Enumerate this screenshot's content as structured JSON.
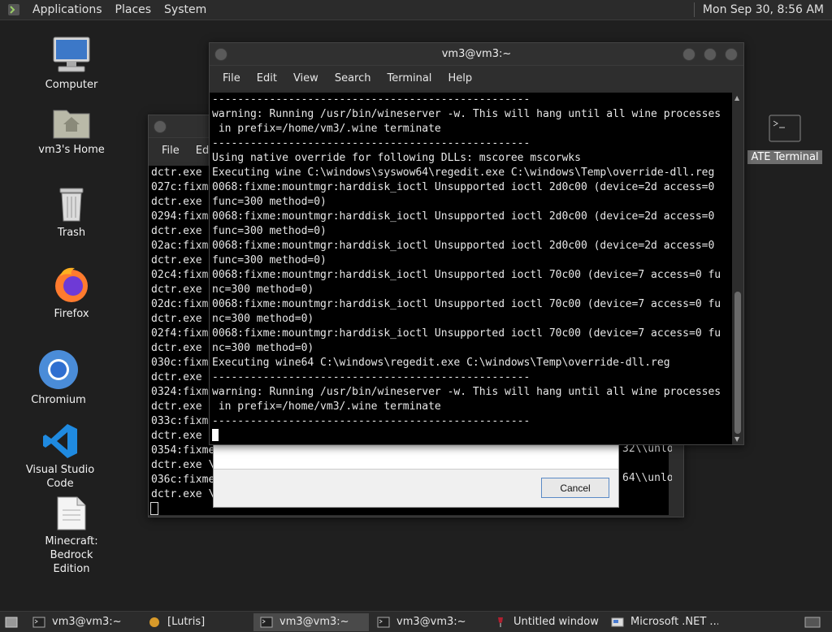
{
  "top_panel": {
    "menus": [
      "Applications",
      "Places",
      "System"
    ],
    "clock": "Mon Sep 30,  8:56 AM"
  },
  "desktop_icons": [
    {
      "label": "Computer",
      "icon": "computer-icon"
    },
    {
      "label": "vm3's Home",
      "icon": "home-folder-icon"
    },
    {
      "label": "Trash",
      "icon": "trash-icon"
    },
    {
      "label": "Firefox",
      "icon": "firefox-icon"
    },
    {
      "label": "Chromium",
      "icon": "chromium-icon"
    },
    {
      "label": "Visual Studio Code",
      "icon": "vscode-icon"
    },
    {
      "label": "Minecraft: Bedrock\nEdition",
      "icon": "document-icon"
    }
  ],
  "main_terminal": {
    "title": "vm3@vm3:~",
    "menu": [
      "File",
      "Edit",
      "View",
      "Search",
      "Terminal",
      "Help"
    ],
    "lines": [
      "--------------------------------------------------",
      "warning: Running /usr/bin/wineserver -w. This will hang until all wine processes",
      " in prefix=/home/vm3/.wine terminate",
      "--------------------------------------------------",
      "Using native override for following DLLs: mscoree mscorwks",
      "Executing wine C:\\windows\\syswow64\\regedit.exe C:\\windows\\Temp\\override-dll.reg",
      "0068:fixme:mountmgr:harddisk_ioctl Unsupported ioctl 2d0c00 (device=2d access=0",
      "func=300 method=0)",
      "0068:fixme:mountmgr:harddisk_ioctl Unsupported ioctl 2d0c00 (device=2d access=0",
      "func=300 method=0)",
      "0068:fixme:mountmgr:harddisk_ioctl Unsupported ioctl 2d0c00 (device=2d access=0",
      "func=300 method=0)",
      "0068:fixme:mountmgr:harddisk_ioctl Unsupported ioctl 70c00 (device=7 access=0 fu",
      "nc=300 method=0)",
      "0068:fixme:mountmgr:harddisk_ioctl Unsupported ioctl 70c00 (device=7 access=0 fu",
      "nc=300 method=0)",
      "0068:fixme:mountmgr:harddisk_ioctl Unsupported ioctl 70c00 (device=7 access=0 fu",
      "nc=300 method=0)",
      "Executing wine64 C:\\windows\\regedit.exe C:\\windows\\Temp\\override-dll.reg",
      "--------------------------------------------------",
      "warning: Running /usr/bin/wineserver -w. This will hang until all wine processes",
      " in prefix=/home/vm3/.wine terminate",
      "--------------------------------------------------"
    ]
  },
  "back_terminal": {
    "menu": [
      "File",
      "Edit"
    ],
    "lines": [
      "dctr.exe",
      "027c:fixme",
      "dctr.exe",
      "0294:fixme",
      "dctr.exe",
      "02ac:fixme",
      "dctr.exe",
      "02c4:fixme",
      "dctr.exe",
      "02dc:fixme",
      "dctr.exe",
      "02f4:fixme",
      "dctr.exe",
      "030c:fixme",
      "dctr.exe",
      "0324:fixme",
      "dctr.exe",
      "033c:fixme",
      "dctr.exe",
      "0354:fixme",
      "dctr.exe \\",
      "036c:fixme",
      "dctr.exe \\"
    ],
    "right_fragments": [
      "32\\\\unlo",
      "64\\\\unlo"
    ]
  },
  "dialog": {
    "cancel_label": "Cancel"
  },
  "mate_terminal_icon": {
    "label": "ATE Terminal"
  },
  "taskbar": [
    {
      "label": "vm3@vm3:~",
      "icon": "terminal-icon",
      "active": false
    },
    {
      "label": "[Lutris]",
      "icon": "lutris-icon",
      "active": false
    },
    {
      "label": "vm3@vm3:~",
      "icon": "terminal-icon",
      "active": true
    },
    {
      "label": "vm3@vm3:~",
      "icon": "terminal-icon",
      "active": false
    },
    {
      "label": "Untitled window",
      "icon": "wine-icon",
      "active": false
    },
    {
      "label": "Microsoft .NET ...",
      "icon": "installer-icon",
      "active": false
    }
  ]
}
